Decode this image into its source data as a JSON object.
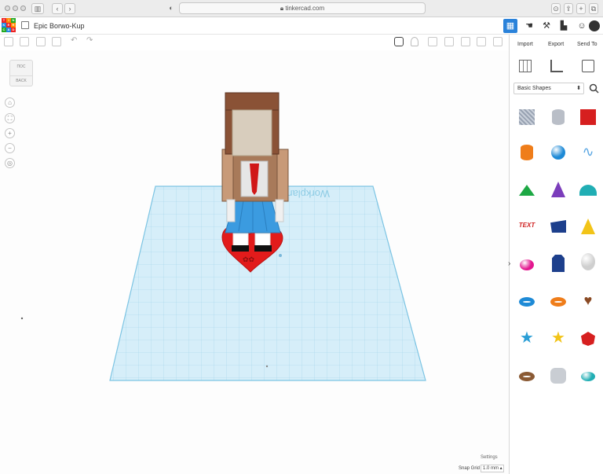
{
  "browser": {
    "address": "tinkercad.com"
  },
  "app": {
    "logo_letters": [
      "T",
      "I",
      "N",
      "K",
      "E",
      "R",
      "C",
      "A",
      "D"
    ],
    "design_title": "Epic Borwo-Kup"
  },
  "panel": {
    "import_label": "Import",
    "export_label": "Export",
    "send_label": "Send To",
    "category": "Basic Shapes"
  },
  "view_cube": {
    "top_label": "ПОС",
    "back_label": "BACK"
  },
  "workplane_label": "Workplane",
  "footer": {
    "settings_label": "Settings",
    "snap_label": "Snap Grid",
    "snap_value": "1.0 mm ▴"
  },
  "colors": {
    "accent": "#2a82da",
    "grid": "#cfeaf7",
    "grid_line": "#8ecbe6",
    "heart": "#e02020"
  },
  "shapes": [
    {
      "name": "box-hole",
      "color": "#a9b3c2"
    },
    {
      "name": "cylinder-hole",
      "color": "#b9bec7"
    },
    {
      "name": "box",
      "color": "#d61f1f"
    },
    {
      "name": "cylinder",
      "color": "#ef7d1a"
    },
    {
      "name": "sphere",
      "color": "#1e8ad6"
    },
    {
      "name": "scribble",
      "color": "#5aa7e3"
    },
    {
      "name": "roof",
      "color": "#1da844"
    },
    {
      "name": "cone",
      "color": "#7b3dbb"
    },
    {
      "name": "round-roof",
      "color": "#21aeb4"
    },
    {
      "name": "text",
      "color": "#cf2020"
    },
    {
      "name": "wedge",
      "color": "#1d3f8c"
    },
    {
      "name": "pyramid",
      "color": "#f2c418"
    },
    {
      "name": "half-sphere",
      "color": "#e3178f"
    },
    {
      "name": "polygon",
      "color": "#1d3f8c"
    },
    {
      "name": "paraboloid",
      "color": "#cfcfcf"
    },
    {
      "name": "torus",
      "color": "#1e8ad6"
    },
    {
      "name": "tube",
      "color": "#ef7d1a"
    },
    {
      "name": "heart",
      "color": "#8a4a24"
    },
    {
      "name": "star",
      "color": "#2a9ed6"
    },
    {
      "name": "star-gold",
      "color": "#f2c418"
    },
    {
      "name": "icosahedron",
      "color": "#d61f1f"
    },
    {
      "name": "ring",
      "color": "#8a5a34"
    },
    {
      "name": "rounded-box",
      "color": "#c9cdd3"
    },
    {
      "name": "ellipsoid",
      "color": "#21aeb4"
    }
  ]
}
